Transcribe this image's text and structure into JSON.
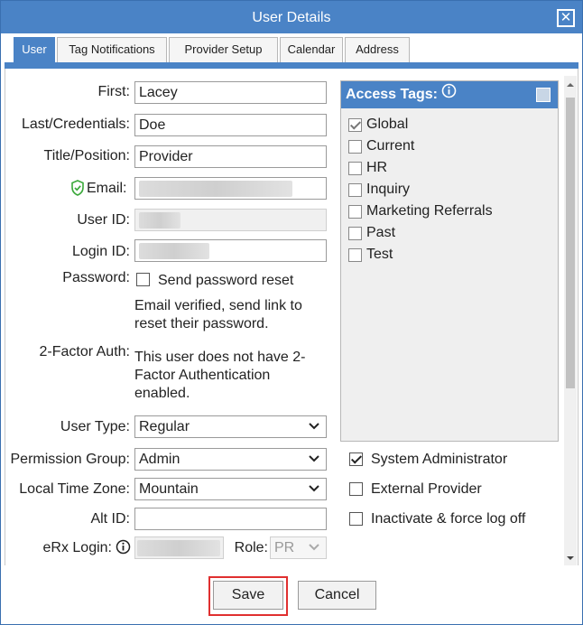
{
  "window": {
    "title": "User Details"
  },
  "tabs": [
    {
      "label": "User",
      "active": true
    },
    {
      "label": "Tag Notifications",
      "active": false
    },
    {
      "label": "Provider Setup",
      "active": false
    },
    {
      "label": "Calendar",
      "active": false
    },
    {
      "label": "Address",
      "active": false
    }
  ],
  "form": {
    "first": {
      "label": "First:",
      "value": "Lacey"
    },
    "last": {
      "label": "Last/Credentials:",
      "value": "Doe"
    },
    "title": {
      "label": "Title/Position:",
      "value": "Provider"
    },
    "email": {
      "label": "Email:",
      "value": ""
    },
    "user_id": {
      "label": "User ID:",
      "value": ""
    },
    "login_id": {
      "label": "Login ID:",
      "value": ""
    },
    "password": {
      "label": "Password:",
      "checkbox_label": "Send password reset",
      "checked": false,
      "note": "Email verified, send link to reset their password."
    },
    "two_factor": {
      "label": "2-Factor Auth:",
      "note": "This user does not have 2-Factor Authentication enabled."
    },
    "user_type": {
      "label": "User Type:",
      "value": "Regular"
    },
    "permission_group": {
      "label": "Permission Group:",
      "value": "Admin"
    },
    "time_zone": {
      "label": "Local Time Zone:",
      "value": "Mountain"
    },
    "alt_id": {
      "label": "Alt ID:",
      "value": ""
    },
    "erx_login": {
      "label": "eRx Login:",
      "value": ""
    },
    "role": {
      "label": "Role:",
      "value": "PR"
    }
  },
  "access_tags": {
    "title": "Access Tags:",
    "items": [
      {
        "label": "Global",
        "checked": true
      },
      {
        "label": "Current",
        "checked": false
      },
      {
        "label": "HR",
        "checked": false
      },
      {
        "label": "Inquiry",
        "checked": false
      },
      {
        "label": "Marketing Referrals",
        "checked": false
      },
      {
        "label": "Past",
        "checked": false
      },
      {
        "label": "Test",
        "checked": false
      }
    ]
  },
  "options": [
    {
      "label": "System Administrator",
      "checked": true
    },
    {
      "label": "External Provider",
      "checked": false
    },
    {
      "label": "Inactivate & force log off",
      "checked": false
    }
  ],
  "buttons": {
    "save": "Save",
    "cancel": "Cancel"
  },
  "colors": {
    "accent": "#4a83c6",
    "verified": "#3aa83a",
    "highlight": "#e03030"
  }
}
